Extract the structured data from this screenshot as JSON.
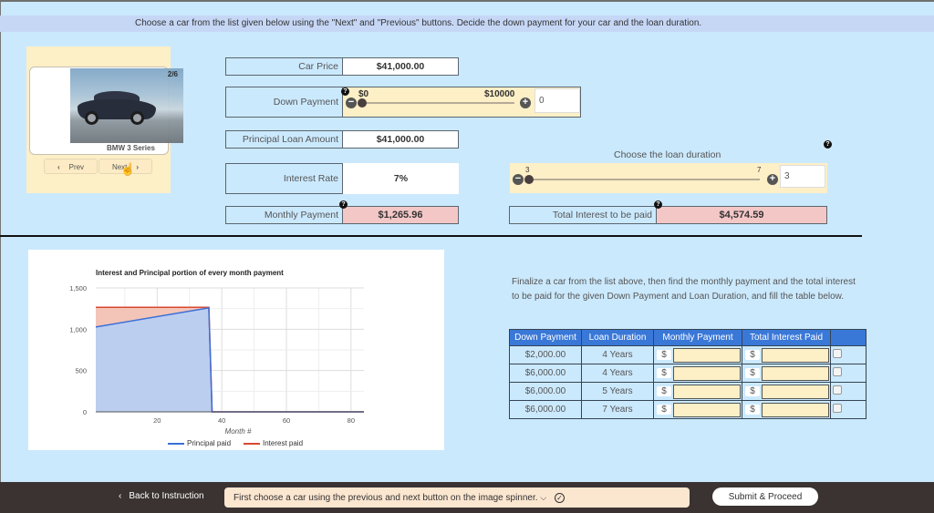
{
  "instruction": "Choose a car from the list given below using the \"Next\" and \"Previous\" buttons. Decide the down payment for your car and the loan duration.",
  "spinner": {
    "counter": "2/6",
    "car_name": "BMW 3 Series",
    "prev_label": "Prev",
    "next_label": "Next",
    "prev_icon": "chevron-left-icon",
    "next_icon": "chevron-right-icon"
  },
  "form": {
    "car_price": {
      "label": "Car Price",
      "value": "$41,000.00"
    },
    "down_payment": {
      "label": "Down Payment",
      "min_label": "$0",
      "max_label": "$10000",
      "input_value": "0",
      "slider_fraction": 0
    },
    "principal": {
      "label": "Principal Loan Amount",
      "value": "$41,000.00"
    },
    "interest_rate": {
      "label": "Interest Rate",
      "value": "7%"
    },
    "monthly_payment": {
      "label": "Monthly Payment",
      "value": "$1,265.96"
    },
    "loan_duration": {
      "title": "Choose the loan duration",
      "min_label": "3",
      "max_label": "7",
      "input_value": "3",
      "slider_fraction": 0
    },
    "total_interest": {
      "label": "Total Interest to be paid",
      "value": "$4,574.59"
    },
    "help_glyph": "?"
  },
  "chart_data": {
    "type": "area",
    "stacked": true,
    "title": "Interest and Principal portion of every month payment",
    "xlabel": "Month #",
    "ylabel": "",
    "xlim": [
      1,
      84
    ],
    "ylim": [
      0,
      1500
    ],
    "xticks": [
      20,
      40,
      60,
      80
    ],
    "yticks": [
      0,
      500,
      1000,
      1500
    ],
    "ytick_labels": [
      "0",
      "500",
      "1,000",
      "1,500"
    ],
    "grid": true,
    "legend": "bottom",
    "series": [
      {
        "name": "Principal paid",
        "color": "#3c6fd6",
        "fill": "#bccef0",
        "points": [
          [
            1,
            1026.79
          ],
          [
            36,
            1258.62
          ],
          [
            37,
            0
          ],
          [
            84,
            0
          ]
        ]
      },
      {
        "name": "Interest paid",
        "color": "#d9482f",
        "fill": "#f3c4b8",
        "points": [
          [
            1,
            239.17
          ],
          [
            36,
            7.34
          ],
          [
            37,
            0
          ],
          [
            84,
            0
          ]
        ]
      }
    ],
    "total_monthly": 1265.96
  },
  "final": {
    "text": "Finalize a car from the list above, then find the monthly payment and the total interest to be paid for the given Down Payment and Loan Duration, and fill the table below.",
    "headers": [
      "Down Payment",
      "Loan Duration",
      "Monthly Payment",
      "Total Interest Paid",
      ""
    ],
    "currency": "$",
    "rows": [
      {
        "down": "$2,000.00",
        "duration": "4 Years",
        "monthly": "",
        "interest": ""
      },
      {
        "down": "$6,000.00",
        "duration": "4 Years",
        "monthly": "",
        "interest": ""
      },
      {
        "down": "$6,000.00",
        "duration": "5 Years",
        "monthly": "",
        "interest": ""
      },
      {
        "down": "$6,000.00",
        "duration": "7 Years",
        "monthly": "",
        "interest": ""
      }
    ]
  },
  "footer": {
    "back_label": "Back to Instruction",
    "hint": "First choose a car using the previous and next button on the image spinner.",
    "submit_label": "Submit & Proceed"
  }
}
